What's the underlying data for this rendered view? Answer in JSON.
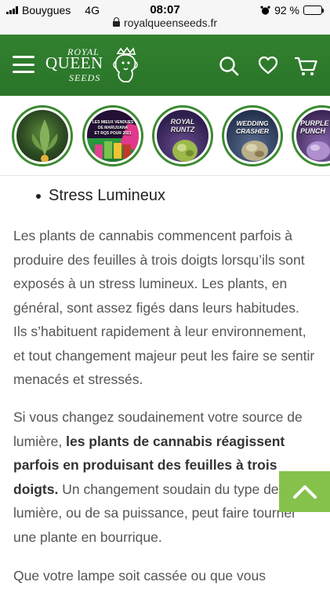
{
  "status_bar": {
    "carrier": "Bouygues",
    "network": "4G",
    "time": "08:07",
    "battery": "92 %",
    "battery_level": 0.92
  },
  "url_bar": {
    "domain": "royalqueenseeds.fr"
  },
  "header": {
    "logo": {
      "line1": "ROYAL",
      "line2": "QUEEN",
      "line3": "SEEDS"
    },
    "icons": [
      "menu-icon",
      "search-icon",
      "heart-icon",
      "cart-icon"
    ],
    "background": "#2e7b2c"
  },
  "carousel": {
    "items": [
      {
        "name": "strain-1",
        "lines": [],
        "bg": "#1f3a1a",
        "accent": "#6aa84f"
      },
      {
        "name": "strain-les-meilleures-varietes",
        "lines": [
          "LES MIEUX VENDUES",
          "DE MARIJUANA",
          "ET RQS POUR 2021"
        ],
        "bg": "#2a1140",
        "accent": "#e0388a"
      },
      {
        "name": "strain-royal-runtz",
        "lines": [
          "ROYAL",
          "RUNTZ"
        ],
        "bg": "#3b2960",
        "accent": "#9bb84a"
      },
      {
        "name": "strain-wedding-crasher",
        "lines": [
          "WEDDING",
          "CRASHER"
        ],
        "bg": "#34476e",
        "accent": "#c4a37a"
      },
      {
        "name": "strain-purple-punch",
        "lines": [
          "PURPLE",
          "PUNCH"
        ],
        "bg": "#5a3b7a",
        "accent": "#b08fce"
      }
    ]
  },
  "article": {
    "heading": "Stress Lumineux",
    "p1": "Les plants de cannabis commencent parfois à produire des feuilles à trois doigts lorsqu’ils sont exposés à un stress lumineux. Les plants, en général, sont assez figés dans leurs habitudes. Ils s’habituent rapidement à leur environnement, et tout changement majeur peut les faire se sentir menacés et stressés.",
    "p2_before": "Si vous changez soudainement votre source de lumière, ",
    "p2_bold": "les plants de cannabis réagissent parfois en produisant des feuilles à trois doigts.",
    "p2_after": " Un changement soudain du type de lumière, ou de sa puissance, peut faire tourner une plante en bourrique.",
    "p3": "Que votre lampe soit cassée ou que vous"
  },
  "scroll_top": {
    "icon": "chevron-up-icon",
    "color": "#86c14c"
  }
}
